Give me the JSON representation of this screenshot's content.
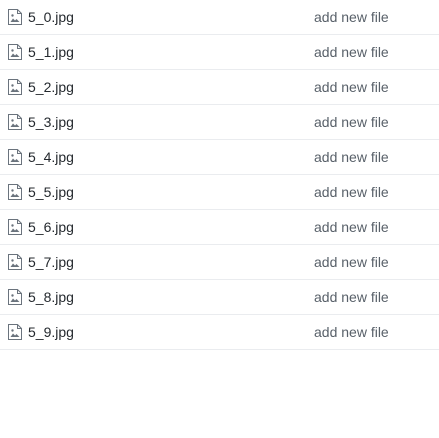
{
  "files": [
    {
      "name": "5_0.jpg",
      "icon": "file-image-icon",
      "commit_message": "add new file"
    },
    {
      "name": "5_1.jpg",
      "icon": "file-image-icon",
      "commit_message": "add new file"
    },
    {
      "name": "5_2.jpg",
      "icon": "file-image-icon",
      "commit_message": "add new file"
    },
    {
      "name": "5_3.jpg",
      "icon": "file-image-icon",
      "commit_message": "add new file"
    },
    {
      "name": "5_4.jpg",
      "icon": "file-image-icon",
      "commit_message": "add new file"
    },
    {
      "name": "5_5.jpg",
      "icon": "file-image-icon",
      "commit_message": "add new file"
    },
    {
      "name": "5_6.jpg",
      "icon": "file-image-icon",
      "commit_message": "add new file"
    },
    {
      "name": "5_7.jpg",
      "icon": "file-image-icon",
      "commit_message": "add new file"
    },
    {
      "name": "5_8.jpg",
      "icon": "file-image-icon",
      "commit_message": "add new file"
    },
    {
      "name": "5_9.jpg",
      "icon": "file-image-icon",
      "commit_message": "add new file"
    }
  ],
  "colors": {
    "text": "#24292e",
    "muted": "#586069",
    "border": "#eaecef",
    "icon": "#6a737d"
  }
}
